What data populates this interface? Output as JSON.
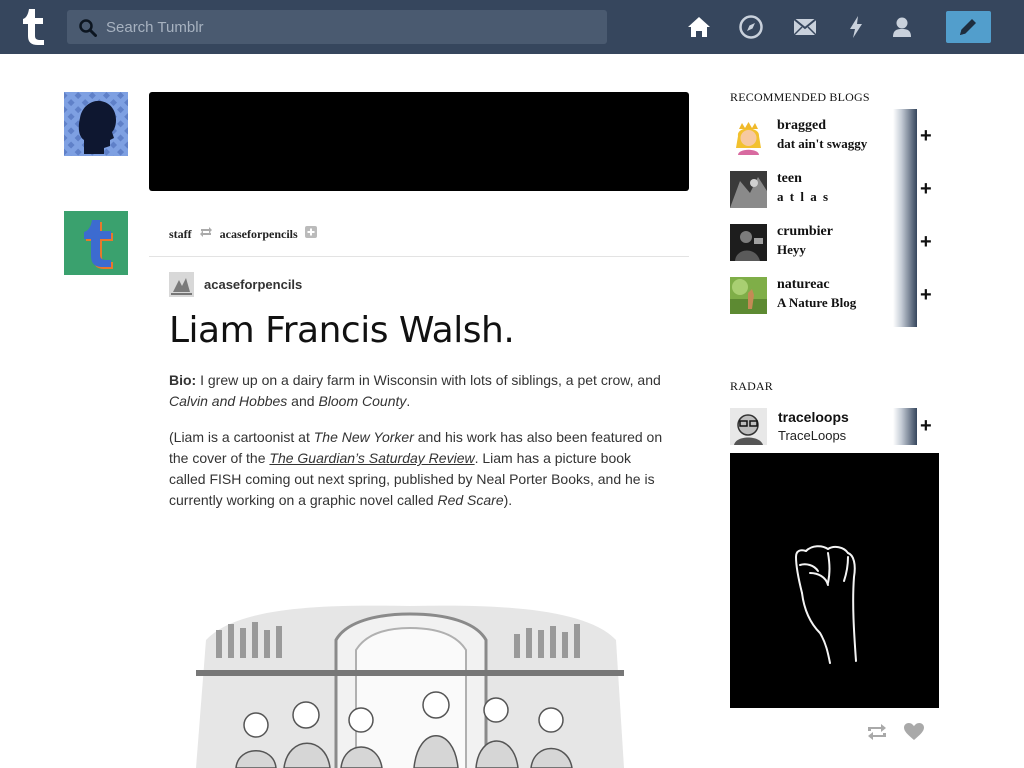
{
  "search": {
    "placeholder": "Search Tumblr"
  },
  "nav": {
    "items": [
      "home-icon",
      "explore-icon",
      "inbox-icon",
      "activity-icon",
      "account-icon"
    ],
    "compose": "pencil-icon"
  },
  "post": {
    "reblog_from": "staff",
    "reblog_to": "acaseforpencils",
    "author": "acaseforpencils",
    "title": "Liam Francis Walsh.",
    "bio_label": "Bio:",
    "bio_text_1": " I grew up on a dairy farm in Wisconsin with lots of siblings, a pet crow, and ",
    "bio_em_1": "Calvin and Hobbes",
    "bio_text_2": " and ",
    "bio_em_2": "Bloom County",
    "bio_text_3": ".",
    "p2_1": "(Liam is a cartoonist at ",
    "p2_em_1": "The New Yorker",
    "p2_2": " and his work has also been featured on the cover of the ",
    "p2_link": "The Guardian’s Saturday Review",
    "p2_3": ". Liam has a picture book called FISH coming out next spring, published by Neal Porter Books, and he is currently working on a graphic novel called ",
    "p2_em_2": "Red Scare",
    "p2_4": ")."
  },
  "recommended": {
    "title": "RECOMMENDED BLOGS",
    "blogs": [
      {
        "name": "bragged",
        "desc": "dat ain't swaggy"
      },
      {
        "name": "teen",
        "desc": "a t l a s"
      },
      {
        "name": "crumbier",
        "desc": "Heyy"
      },
      {
        "name": "natureac",
        "desc": "A Nature Blog"
      }
    ],
    "follow": "+"
  },
  "radar": {
    "title": "RADAR",
    "name": "traceloops",
    "desc": "TraceLoops",
    "follow": "+"
  },
  "colors": {
    "topbar": "#36465d",
    "compose": "#529ecc"
  }
}
